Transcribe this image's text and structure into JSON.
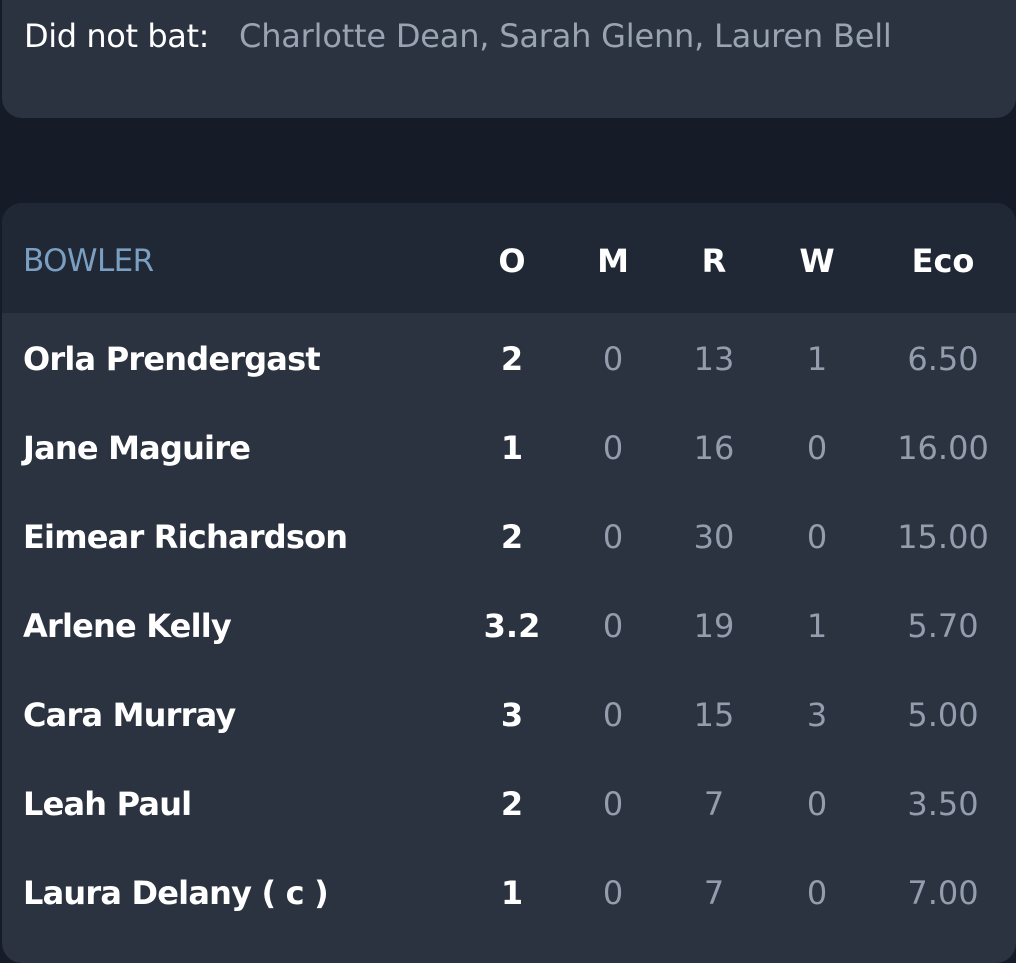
{
  "did_not_bat": {
    "label": "Did not bat:",
    "names": "Charlotte Dean, Sarah Glenn, Lauren Bell"
  },
  "bowling": {
    "headers": {
      "bowler": "BOWLER",
      "overs": "O",
      "maidens": "M",
      "runs": "R",
      "wickets": "W",
      "economy": "Eco"
    },
    "rows": [
      {
        "name": "Orla Prendergast",
        "o": "2",
        "m": "0",
        "r": "13",
        "w": "1",
        "eco": "6.50"
      },
      {
        "name": "Jane Maguire",
        "o": "1",
        "m": "0",
        "r": "16",
        "w": "0",
        "eco": "16.00"
      },
      {
        "name": "Eimear Richardson",
        "o": "2",
        "m": "0",
        "r": "30",
        "w": "0",
        "eco": "15.00"
      },
      {
        "name": "Arlene Kelly",
        "o": "3.2",
        "m": "0",
        "r": "19",
        "w": "1",
        "eco": "5.70"
      },
      {
        "name": "Cara Murray",
        "o": "3",
        "m": "0",
        "r": "15",
        "w": "3",
        "eco": "5.00"
      },
      {
        "name": "Leah Paul",
        "o": "2",
        "m": "0",
        "r": "7",
        "w": "0",
        "eco": "3.50"
      },
      {
        "name": "Laura Delany  ( c )",
        "o": "1",
        "m": "0",
        "r": "7",
        "w": "0",
        "eco": "7.00"
      }
    ]
  }
}
